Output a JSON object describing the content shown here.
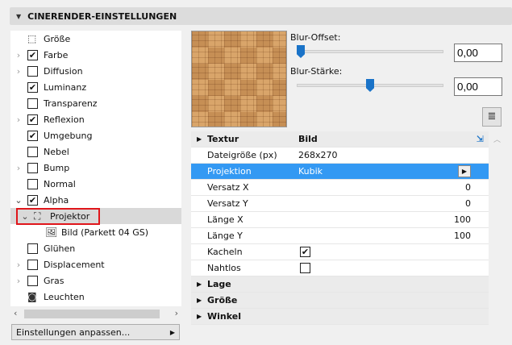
{
  "header": {
    "title": "CINERENDER-EINSTELLUNGEN"
  },
  "tree": [
    {
      "label": "Größe",
      "checkbox": null,
      "expander": null,
      "icon": "size-icon"
    },
    {
      "label": "Farbe",
      "checkbox": true,
      "expander": "collapsed"
    },
    {
      "label": "Diffusion",
      "checkbox": false,
      "expander": "collapsed"
    },
    {
      "label": "Luminanz",
      "checkbox": true,
      "expander": null
    },
    {
      "label": "Transparenz",
      "checkbox": false,
      "expander": null
    },
    {
      "label": "Reflexion",
      "checkbox": true,
      "expander": "collapsed"
    },
    {
      "label": "Umgebung",
      "checkbox": true,
      "expander": null
    },
    {
      "label": "Nebel",
      "checkbox": false,
      "expander": null
    },
    {
      "label": "Bump",
      "checkbox": false,
      "expander": "collapsed"
    },
    {
      "label": "Normal",
      "checkbox": false,
      "expander": null
    },
    {
      "label": "Alpha",
      "checkbox": true,
      "expander": "expanded"
    },
    {
      "label": "Projektor",
      "checkbox": null,
      "expander": "expanded",
      "icon": "projector-icon",
      "selected": true
    },
    {
      "label": "Bild (Parkett 04 GS)",
      "checkbox": null,
      "expander": null,
      "icon": "image-icon"
    },
    {
      "label": "Glühen",
      "checkbox": false,
      "expander": null
    },
    {
      "label": "Displacement",
      "checkbox": false,
      "expander": "collapsed"
    },
    {
      "label": "Gras",
      "checkbox": false,
      "expander": "collapsed"
    },
    {
      "label": "Leuchten",
      "checkbox": null,
      "expander": null,
      "icon": "light-icon"
    }
  ],
  "settings_button": "Einstellungen anpassen...",
  "blur_offset": {
    "label": "Blur-Offset:",
    "value": "0,00",
    "slider": 0
  },
  "blur_strength": {
    "label": "Blur-Stärke:",
    "value": "0,00",
    "slider": 0.5
  },
  "table": {
    "textur": {
      "label": "Textur",
      "value": "Bild"
    },
    "rows": [
      {
        "label": "Dateigröße (px)",
        "value": "268x270"
      },
      {
        "label": "Projektion",
        "value": "Kubik"
      },
      {
        "label": "Versatz X",
        "value": "0"
      },
      {
        "label": "Versatz Y",
        "value": "0"
      },
      {
        "label": "Länge X",
        "value": "100"
      },
      {
        "label": "Länge Y",
        "value": "100"
      },
      {
        "label": "Kacheln",
        "checked": true
      },
      {
        "label": "Nahtlos",
        "checked": false
      }
    ],
    "groups": [
      "Lage",
      "Größe",
      "Winkel"
    ]
  }
}
